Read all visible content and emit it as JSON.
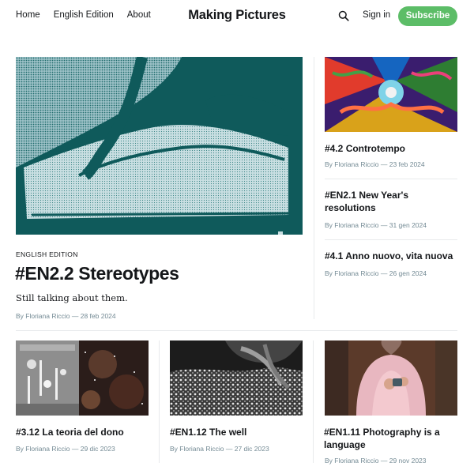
{
  "header": {
    "nav": [
      "Home",
      "English Edition",
      "About"
    ],
    "brand": "Making Pictures",
    "signin_label": "Sign in",
    "subscribe_label": "Subscribe"
  },
  "feature": {
    "tag": "ENGLISH EDITION",
    "title": "#EN2.2 Stereotypes",
    "excerpt": "Still talking about them.",
    "meta": "By Floriana Riccio — 28 feb 2024"
  },
  "sidebar": [
    {
      "title": "#4.2 Controtempo",
      "meta": "By Floriana Riccio — 23 feb 2024"
    },
    {
      "title": "#EN2.1 New Year's resolutions",
      "meta": "By Floriana Riccio — 31 gen 2024"
    },
    {
      "title": "#4.1 Anno nuovo, vita nuova",
      "meta": "By Floriana Riccio — 26 gen 2024"
    }
  ],
  "cards": [
    {
      "title": "#3.12 La teoria del dono",
      "meta": "By Floriana Riccio — 29 dic 2023"
    },
    {
      "title": "#EN1.12 The well",
      "meta": "By Floriana Riccio — 27 dic 2023"
    },
    {
      "title": "#EN1.11 Photography is a language",
      "meta": "By Floriana Riccio — 29 nov 2023"
    }
  ],
  "colors": {
    "accent": "#5cbd67",
    "text": "#15171a",
    "meta": "#738a94",
    "divider": "#e8eaec"
  },
  "icons": {
    "search": "search-icon"
  }
}
